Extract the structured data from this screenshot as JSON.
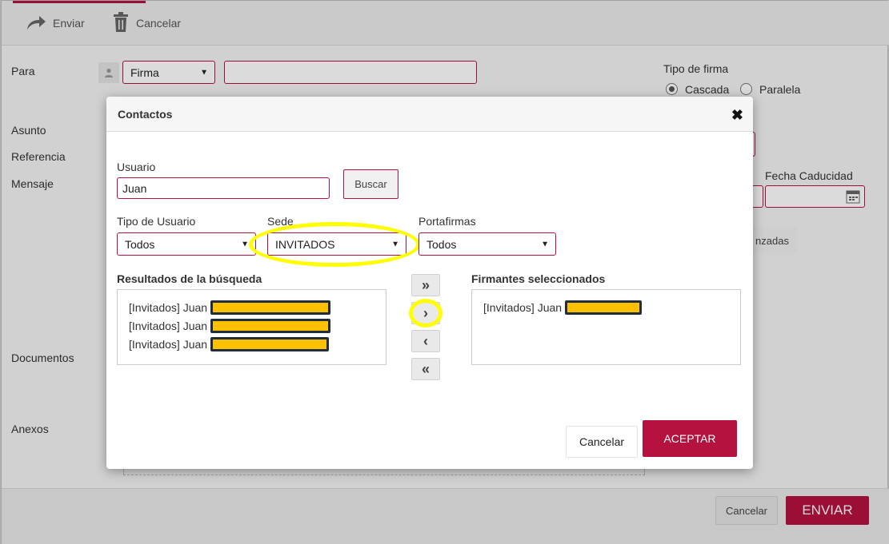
{
  "toolbar": {
    "send_label": "Enviar",
    "cancel_label": "Cancelar"
  },
  "form": {
    "para_label": "Para",
    "para_type_value": "Firma",
    "asunto_label": "Asunto",
    "referencia_label": "Referencia",
    "mensaje_label": "Mensaje",
    "documentos_label": "Documentos",
    "anexos_label": "Anexos",
    "tipo_firma_label": "Tipo de firma",
    "cascada_label": "Cascada",
    "paralela_label": "Paralela",
    "fecha_caducidad_label": "Fecha Caducidad",
    "avanzadas_label": "nzadas"
  },
  "modal": {
    "title": "Contactos",
    "usuario_label": "Usuario",
    "usuario_value": "Juan",
    "buscar_label": "Buscar",
    "tipo_usuario_label": "Tipo de Usuario",
    "tipo_usuario_value": "Todos",
    "sede_label": "Sede",
    "sede_value": "INVITADOS",
    "portafirmas_label": "Portafirmas",
    "portafirmas_value": "Todos",
    "resultados_label": "Resultados de la búsqueda",
    "results": [
      "[Invitados] Juan",
      "[Invitados] Juan",
      "[Invitados] Juan"
    ],
    "firmantes_label": "Firmantes seleccionados",
    "selected": [
      "[Invitados] Juan"
    ],
    "move_all_right": "»",
    "move_right": "›",
    "move_left": "‹",
    "move_all_left": "«",
    "cancelar_label": "Cancelar",
    "aceptar_label": "ACEPTAR"
  },
  "footer": {
    "cancelar_label": "Cancelar",
    "enviar_label": "ENVIAR"
  },
  "colors": {
    "accent": "#b5123f",
    "highlight": "#ffff00",
    "redaction": "#ffc000"
  },
  "icons": {
    "send": "share-arrow-icon",
    "trash": "trash-icon",
    "user": "user-icon",
    "close": "close-icon",
    "calendar": "calendar-icon"
  }
}
